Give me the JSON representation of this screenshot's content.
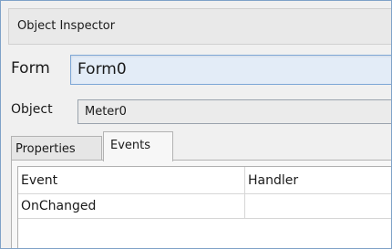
{
  "window": {
    "title": "Object Inspector"
  },
  "form": {
    "label": "Form",
    "value": "Form0"
  },
  "object": {
    "label": "Object",
    "value": "Meter0"
  },
  "tabs": [
    {
      "label": "Properties",
      "active": false
    },
    {
      "label": "Events",
      "active": true
    }
  ],
  "grid": {
    "columns": [
      "Event",
      "Handler"
    ],
    "rows": [
      {
        "event": "OnChanged",
        "handler": ""
      }
    ]
  },
  "colors": {
    "window_border": "#7fa2c8",
    "form_field_bg": "#e3ecf7",
    "form_field_border": "#7ea7d6"
  }
}
